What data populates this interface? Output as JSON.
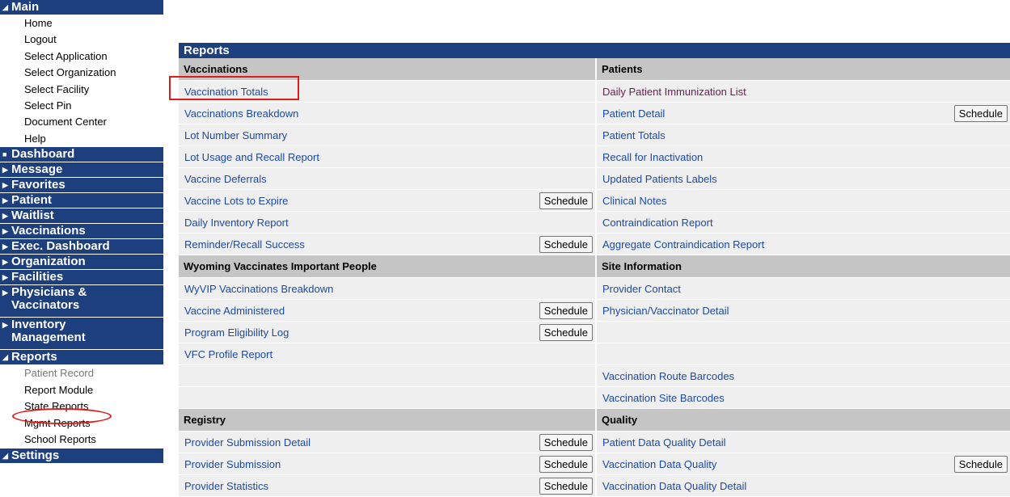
{
  "sidebar": {
    "main": {
      "label": "Main",
      "items": [
        "Home",
        "Logout",
        "Select Application",
        "Select Organization",
        "Select Facility",
        "Select Pin",
        "Document Center",
        "Help"
      ]
    },
    "sections_a": [
      "Dashboard",
      "Message",
      "Favorites",
      "Patient",
      "Waitlist",
      "Vaccinations",
      "Exec. Dashboard",
      "Organization",
      "Facilities"
    ],
    "physicians": "Physicians &\nVaccinators",
    "inventory": "Inventory\nManagement",
    "reports": {
      "label": "Reports",
      "items": [
        "Patient Record",
        "Report Module",
        "State Reports",
        "Mgmt Reports",
        "School Reports"
      ]
    },
    "partial": "Settings"
  },
  "main": {
    "title": "Reports",
    "schedule_label": "Schedule",
    "left": [
      {
        "type": "header",
        "label": "Vaccinations"
      },
      {
        "type": "link",
        "label": "Vaccination Totals"
      },
      {
        "type": "link",
        "label": "Vaccinations Breakdown"
      },
      {
        "type": "link",
        "label": "Lot Number Summary"
      },
      {
        "type": "link",
        "label": "Lot Usage and Recall Report"
      },
      {
        "type": "link",
        "label": "Vaccine Deferrals"
      },
      {
        "type": "link",
        "label": "Vaccine Lots to Expire",
        "schedule": true
      },
      {
        "type": "link",
        "label": "Daily Inventory Report"
      },
      {
        "type": "link",
        "label": "Reminder/Recall Success",
        "schedule": true
      },
      {
        "type": "header",
        "label": "Wyoming Vaccinates Important People"
      },
      {
        "type": "link",
        "label": "WyVIP Vaccinations Breakdown"
      },
      {
        "type": "link",
        "label": "Vaccine Administered",
        "schedule": true
      },
      {
        "type": "link",
        "label": "Program Eligibility Log",
        "schedule": true
      },
      {
        "type": "link",
        "label": "VFC Profile Report"
      },
      {
        "type": "empty",
        "label": ""
      },
      {
        "type": "empty",
        "label": ""
      },
      {
        "type": "header",
        "label": "Registry"
      },
      {
        "type": "link",
        "label": "Provider Submission Detail",
        "schedule": true
      },
      {
        "type": "link",
        "label": "Provider Submission",
        "schedule": true
      },
      {
        "type": "link",
        "label": "Provider Statistics",
        "schedule": true
      }
    ],
    "right": [
      {
        "type": "header",
        "label": "Patients"
      },
      {
        "type": "link",
        "label": "Daily Patient Immunization List",
        "visited": true
      },
      {
        "type": "link",
        "label": "Patient Detail",
        "schedule": true
      },
      {
        "type": "link",
        "label": "Patient Totals"
      },
      {
        "type": "link",
        "label": "Recall for Inactivation"
      },
      {
        "type": "link",
        "label": "Updated Patients Labels"
      },
      {
        "type": "link",
        "label": "Clinical Notes"
      },
      {
        "type": "link",
        "label": "Contraindication Report"
      },
      {
        "type": "link",
        "label": "Aggregate Contraindication Report"
      },
      {
        "type": "header",
        "label": "Site Information"
      },
      {
        "type": "link",
        "label": "Provider Contact"
      },
      {
        "type": "link",
        "label": "Physician/Vaccinator Detail"
      },
      {
        "type": "empty",
        "label": ""
      },
      {
        "type": "empty",
        "label": ""
      },
      {
        "type": "link",
        "label": "Vaccination Route Barcodes"
      },
      {
        "type": "link",
        "label": "Vaccination Site Barcodes"
      },
      {
        "type": "header",
        "label": "Quality"
      },
      {
        "type": "link",
        "label": "Patient Data Quality Detail"
      },
      {
        "type": "link",
        "label": "Vaccination Data Quality",
        "schedule": true
      },
      {
        "type": "link",
        "label": "Vaccination Data Quality Detail"
      }
    ]
  },
  "colors": {
    "nav_bg": "#1e3f7d",
    "header_gray": "#c5c5c5",
    "row_gray": "#efefef",
    "link": "#1d4aa8",
    "visited_link": "#6b1b4f",
    "highlight": "#e31b1b"
  },
  "icons": {
    "expanded": "triangle-down-icon",
    "collapsed": "triangle-right-icon",
    "dashboard": "square-icon"
  }
}
